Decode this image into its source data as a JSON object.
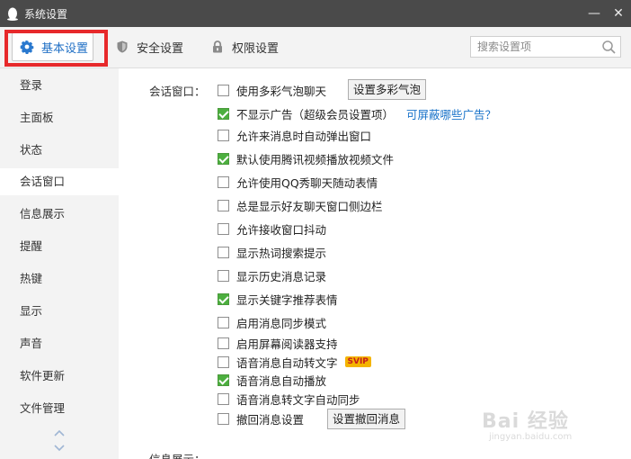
{
  "window": {
    "title": "系统设置",
    "minimize": "—",
    "close": "✕"
  },
  "tabs": [
    {
      "label": "基本设置",
      "icon": "gear-icon",
      "active": true
    },
    {
      "label": "安全设置",
      "icon": "shield-icon",
      "active": false
    },
    {
      "label": "权限设置",
      "icon": "lock-icon",
      "active": false
    }
  ],
  "search": {
    "placeholder": "搜索设置项"
  },
  "sidebar": {
    "items": [
      {
        "label": "登录"
      },
      {
        "label": "主面板"
      },
      {
        "label": "状态"
      },
      {
        "label": "会话窗口",
        "active": true
      },
      {
        "label": "信息展示"
      },
      {
        "label": "提醒"
      },
      {
        "label": "热键"
      },
      {
        "label": "显示"
      },
      {
        "label": "声音"
      },
      {
        "label": "软件更新"
      },
      {
        "label": "文件管理"
      }
    ]
  },
  "content": {
    "section_label": "会话窗口：",
    "options": [
      {
        "label": "使用多彩气泡聊天",
        "checked": false,
        "button": "设置多彩气泡"
      },
      {
        "label": "不显示广告（超级会员设置项）",
        "checked": true,
        "link": "可屏蔽哪些广告？"
      },
      {
        "label": "允许来消息时自动弹出窗口",
        "checked": false
      },
      {
        "label": "默认使用腾讯视频播放视频文件",
        "checked": true
      },
      {
        "label": "允许使用QQ秀聊天随动表情",
        "checked": false
      },
      {
        "label": "总是显示好友聊天窗口侧边栏",
        "checked": false
      },
      {
        "label": "允许接收窗口抖动",
        "checked": false
      },
      {
        "label": "显示热词搜索提示",
        "checked": false
      },
      {
        "label": "显示历史消息记录",
        "checked": false
      },
      {
        "label": "显示关键字推荐表情",
        "checked": true
      },
      {
        "label": "启用消息同步模式",
        "checked": false
      },
      {
        "label": "启用屏幕阅读器支持",
        "checked": false
      },
      {
        "label": "语音消息自动转文字",
        "checked": false,
        "badge": "SVIP"
      },
      {
        "label": "语音消息自动播放",
        "checked": true
      },
      {
        "label": "语音消息转文字自动同步",
        "checked": false
      },
      {
        "label": "撤回消息设置",
        "checked": false,
        "button": "设置撤回消息"
      }
    ],
    "next_section_label": "信息展示："
  },
  "colors": {
    "titlebar": "#4a4a4a",
    "accent": "#1f6fc5",
    "checkbox_checked": "#4caf3f",
    "annotation_red": "#e7292b",
    "link": "#1a73c9"
  },
  "watermark": {
    "text": "Bai 经验",
    "url": "jingyan.baidu.com"
  }
}
